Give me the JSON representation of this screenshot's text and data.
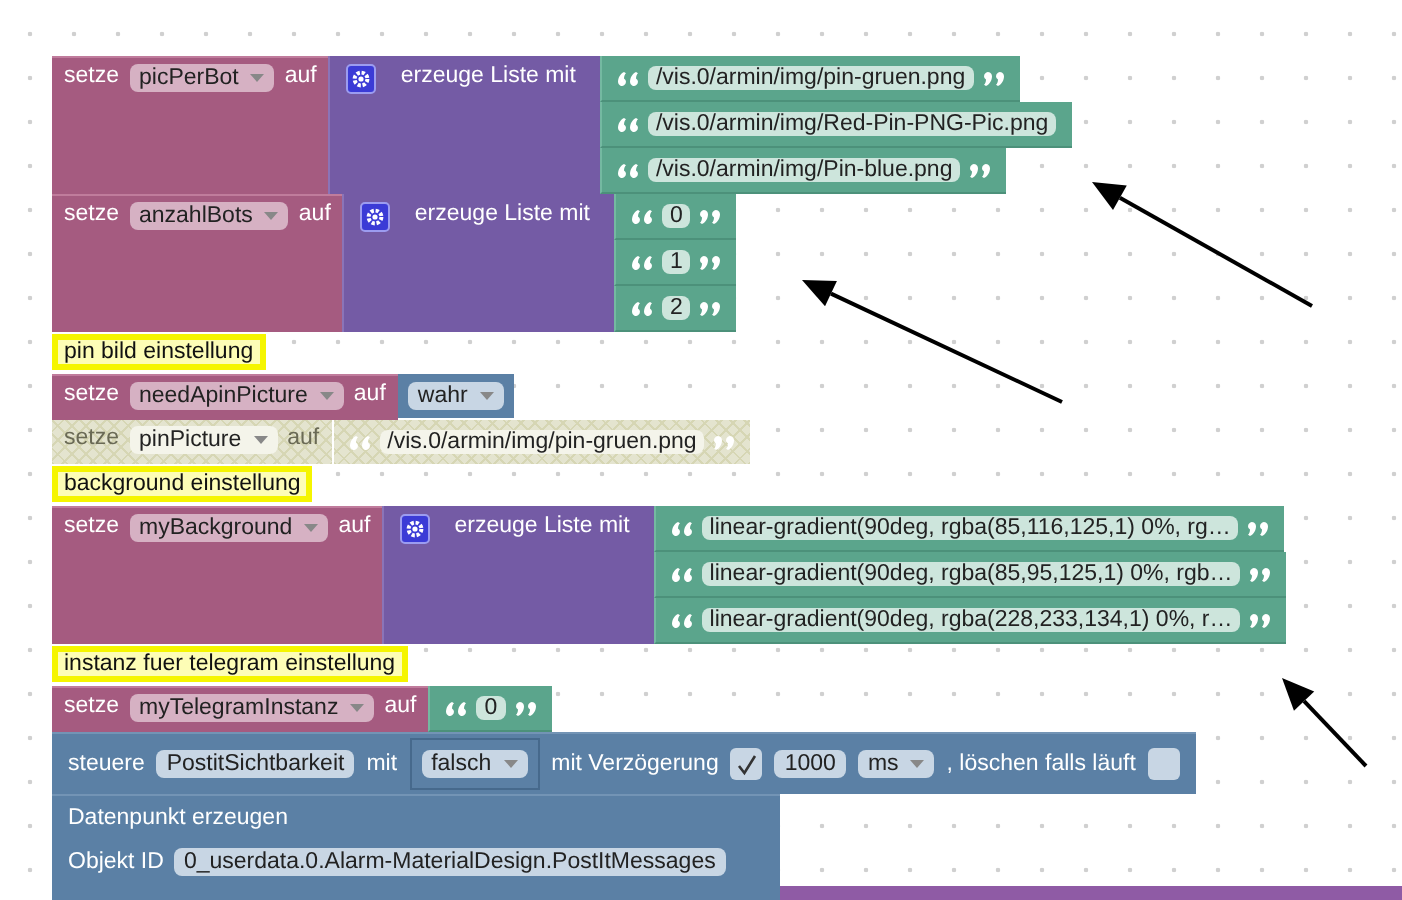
{
  "blocks": [
    {
      "kind": "set",
      "label": "setze",
      "variable": "picPerBot",
      "connector": "auf",
      "disabled": false,
      "value": {
        "kind": "list",
        "label": "erzeuge Liste mit",
        "items": [
          {
            "text": "/vis.0/armin/img/pin-gruen.png",
            "closing_quote": true
          },
          {
            "text": "/vis.0/armin/img/Red-Pin-PNG-Pic.png",
            "closing_quote": false
          },
          {
            "text": "/vis.0/armin/img/Pin-blue.png",
            "closing_quote": true
          }
        ]
      }
    },
    {
      "kind": "set",
      "label": "setze",
      "variable": "anzahlBots",
      "connector": "auf",
      "disabled": false,
      "value": {
        "kind": "list",
        "label": "erzeuge Liste mit",
        "items": [
          {
            "text": "0",
            "closing_quote": true
          },
          {
            "text": "1",
            "closing_quote": true
          },
          {
            "text": "2",
            "closing_quote": true
          }
        ]
      }
    },
    {
      "kind": "comment",
      "text": "pin bild einstellung"
    },
    {
      "kind": "set",
      "label": "setze",
      "variable": "needApinPicture",
      "connector": "auf",
      "disabled": false,
      "value": {
        "kind": "bool",
        "text": "wahr",
        "outlined": false
      }
    },
    {
      "kind": "set",
      "label": "setze",
      "variable": "pinPicture",
      "connector": "auf",
      "disabled": true,
      "value": {
        "kind": "string",
        "text": "/vis.0/armin/img/pin-gruen.png",
        "closing_quote": true
      }
    },
    {
      "kind": "comment",
      "text": "background einstellung"
    },
    {
      "kind": "set",
      "label": "setze",
      "variable": "myBackground",
      "connector": "auf",
      "disabled": false,
      "value": {
        "kind": "list",
        "label": "erzeuge Liste mit",
        "items": [
          {
            "text": "linear-gradient(90deg, rgba(85,116,125,1) 0%, rg…",
            "closing_quote": true
          },
          {
            "text": "linear-gradient(90deg, rgba(85,95,125,1) 0%, rgb…",
            "closing_quote": true
          },
          {
            "text": "linear-gradient(90deg, rgba(228,233,134,1) 0%, r…",
            "closing_quote": true
          }
        ]
      }
    },
    {
      "kind": "comment",
      "text": "instanz fuer telegram einstellung"
    },
    {
      "kind": "set",
      "label": "setze",
      "variable": "myTelegramInstanz",
      "connector": "auf",
      "disabled": false,
      "value": {
        "kind": "string",
        "text": "0",
        "closing_quote": true
      }
    },
    {
      "kind": "control",
      "label": "steuere",
      "target": "PostitSichtbarkeit",
      "with_label": "mit",
      "value": {
        "kind": "bool",
        "text": "falsch",
        "outlined": true
      },
      "delay_label": "mit Verzögerung",
      "delay_checked": true,
      "delay": "1000",
      "unit": "ms",
      "clear_label": ", löschen falls läuft",
      "clear_checked": false
    },
    {
      "kind": "create",
      "title": "Datenpunkt erzeugen",
      "id_label": "Objekt ID",
      "object_id": "0_userdata.0.Alarm-MaterialDesign.PostItMessages"
    }
  ]
}
